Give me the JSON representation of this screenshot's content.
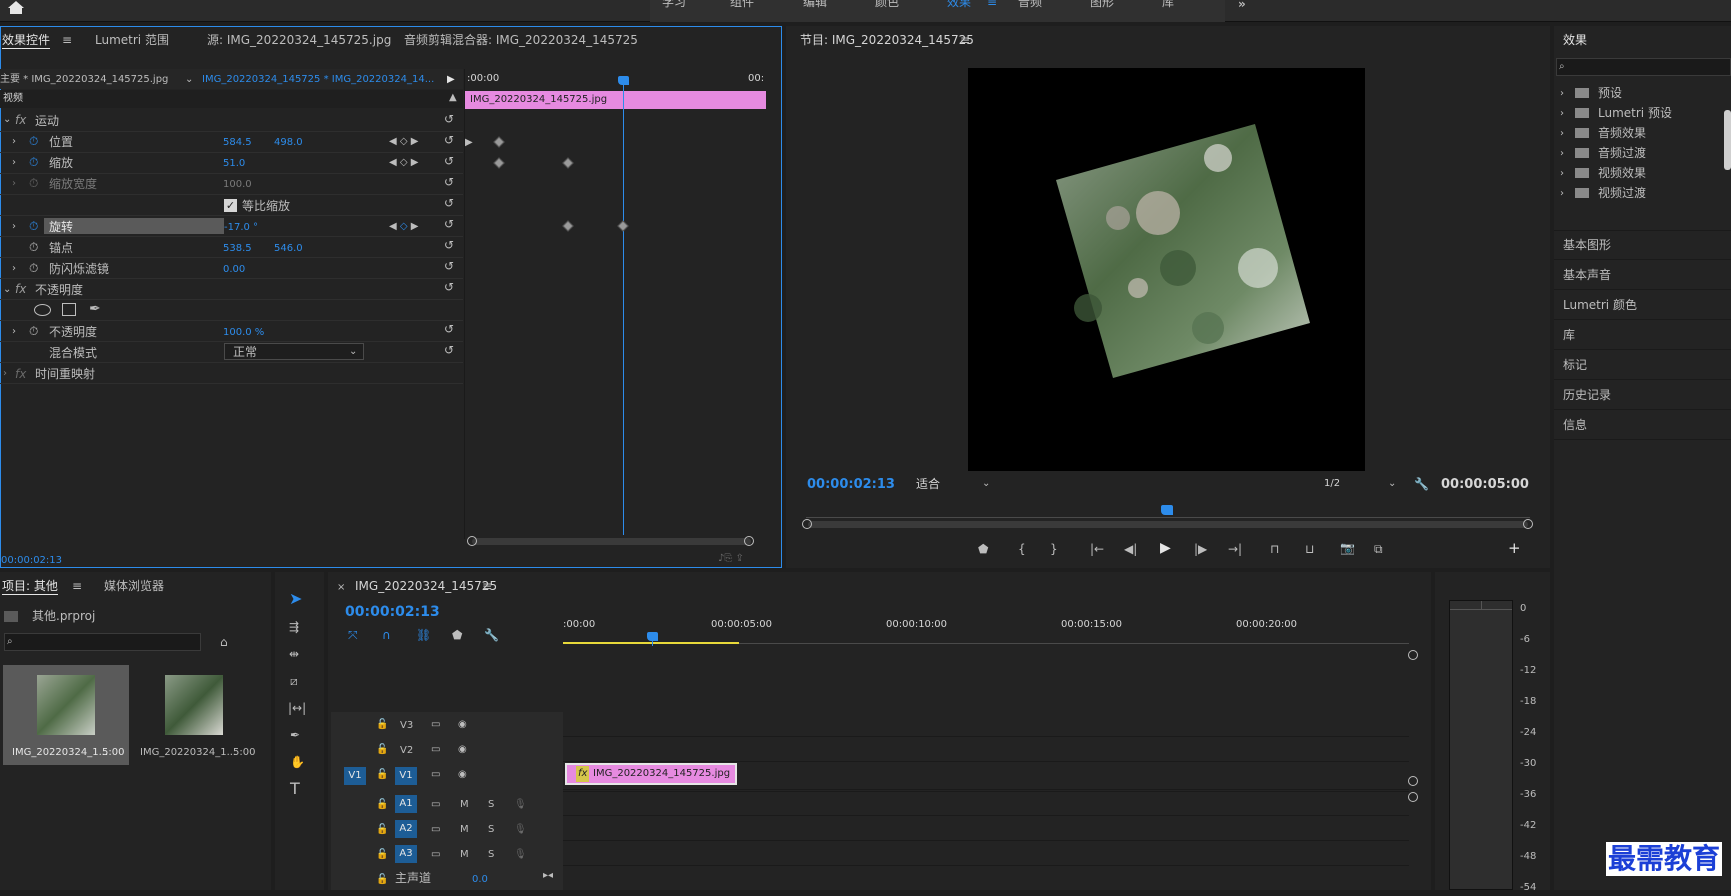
{
  "workspace": {
    "tabs": [
      "学习",
      "组件",
      "编辑",
      "颜色",
      "效果",
      "音频",
      "图形",
      "库"
    ],
    "active": "效果",
    "more": "»"
  },
  "source_panel": {
    "tabs": [
      "效果控件",
      "Lumetri 范围",
      "源: IMG_20220324_145725.jpg",
      "音频剪辑混合器: IMG_20220324_145725"
    ],
    "master_label": "主要 * IMG_20220324_145725.jpg",
    "sequence_label": "IMG_20220324_145725 * IMG_20220324_14...",
    "time_start": ":00:00",
    "time_end": "00:",
    "clip_name": "IMG_20220324_145725.jpg",
    "video_header": "视频",
    "fx_motion": "运动",
    "props": [
      {
        "name": "位置",
        "v1": "584.5",
        "v2": "498.0"
      },
      {
        "name": "缩放",
        "v1": "51.0",
        "v2": ""
      },
      {
        "name": "缩放宽度",
        "v1": "100.0",
        "v2": ""
      },
      {
        "name": "等比缩放",
        "v1": "",
        "v2": ""
      },
      {
        "name": "旋转",
        "v1": "-17.0 °",
        "v2": ""
      },
      {
        "name": "锚点",
        "v1": "538.5",
        "v2": "546.0"
      },
      {
        "name": "防闪烁滤镜",
        "v1": "0.00",
        "v2": ""
      }
    ],
    "fx_opacity": "不透明度",
    "opacity_label": "不透明度",
    "opacity_value": "100.0 %",
    "blend_label": "混合模式",
    "blend_value": "正常",
    "time_remap": "时间重映射",
    "current_time": "00:00:02:13"
  },
  "program_panel": {
    "title": "节目: IMG_20220324_145725",
    "timecode": "00:00:02:13",
    "fit": "适合",
    "resolution": "1/2",
    "duration": "00:00:05:00"
  },
  "effects_panel": {
    "title": "效果",
    "tree": [
      "预设",
      "Lumetri 预设",
      "音频效果",
      "音频过渡",
      "视频效果",
      "视频过渡"
    ],
    "sections": [
      "基本图形",
      "基本声音",
      "Lumetri 颜色",
      "库",
      "标记",
      "历史记录",
      "信息"
    ]
  },
  "project_panel": {
    "tabs": [
      "项目: 其他",
      "媒体浏览器"
    ],
    "project_file": "其他.prproj",
    "items": [
      {
        "name": "IMG_20220324_1...",
        "duration": "5:00"
      },
      {
        "name": "IMG_20220324_1...",
        "duration": "5:00"
      }
    ]
  },
  "timeline": {
    "title": "IMG_20220324_145725",
    "timecode": "00:00:02:13",
    "ruler": [
      ":00:00",
      "00:00:05:00",
      "00:00:10:00",
      "00:00:15:00",
      "00:00:20:00"
    ],
    "video_tracks": [
      "V3",
      "V2",
      "V1"
    ],
    "audio_tracks": [
      "A1",
      "A2",
      "A3"
    ],
    "source_patch": "V1",
    "clip_name": "IMG_20220324_145725.jpg",
    "clip_fx": "fx",
    "master_label": "主声道",
    "master_value": "0.0",
    "mute": "M",
    "solo": "S"
  },
  "meter": {
    "scale": [
      "0",
      "-6",
      "-12",
      "-18",
      "-24",
      "-30",
      "-36",
      "-42",
      "-48",
      "-54"
    ]
  },
  "watermark": "最需教育",
  "colors": {
    "accent": "#2d8ceb",
    "clip": "#e68ae0",
    "track_blue": "#1d5d96",
    "work_area": "#e8d93a"
  }
}
